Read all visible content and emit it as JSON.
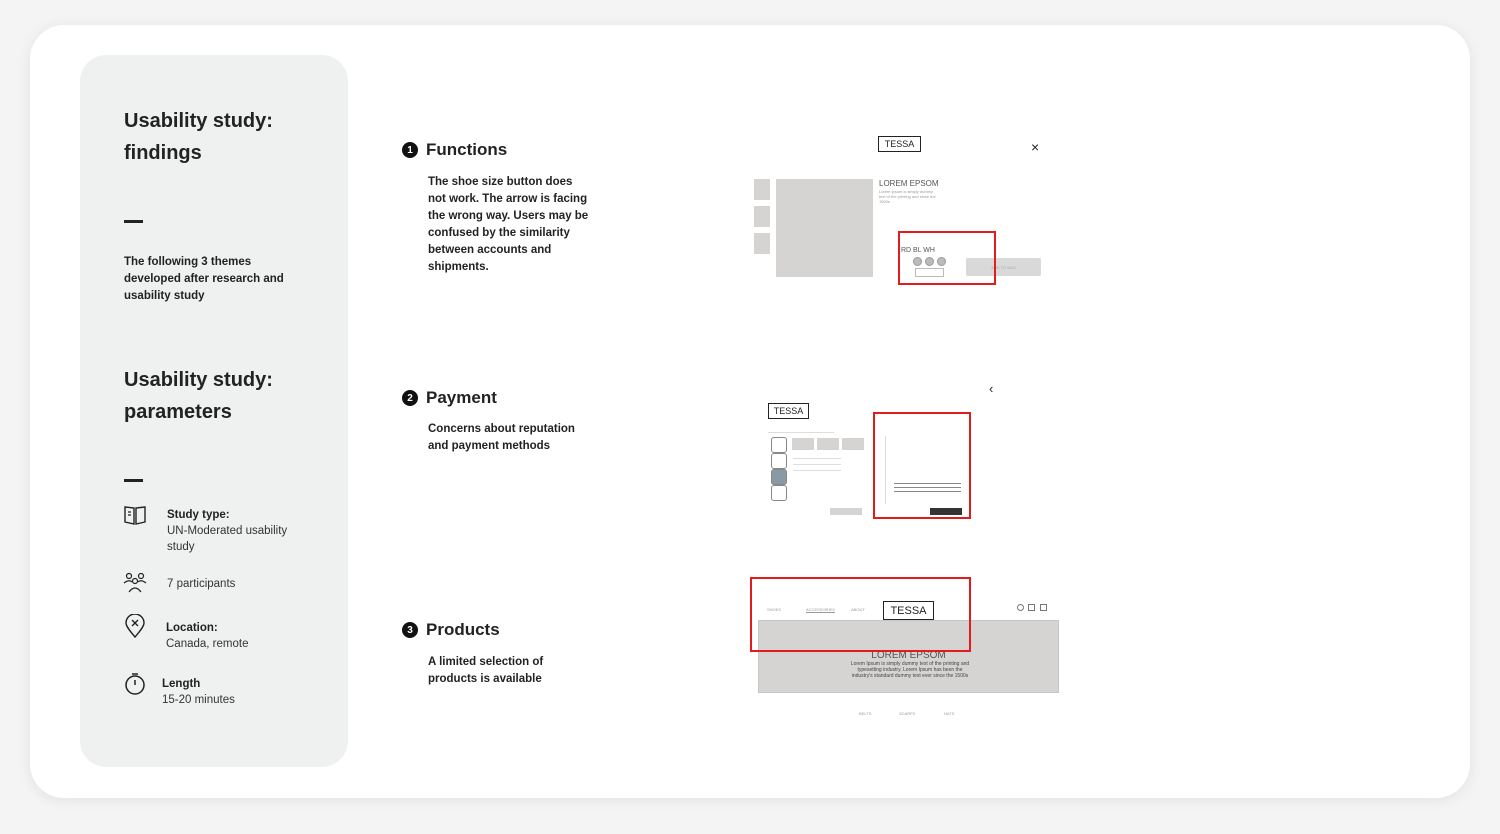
{
  "sidebar": {
    "findings_title_1": "Usability study:",
    "findings_title_2": "findings",
    "intro": "The following 3 themes developed after research and usability study",
    "parameters_title_1": "Usability study:",
    "parameters_title_2": "parameters",
    "params": {
      "study_type_label": "Study type:",
      "study_type_value": "UN-Moderated usability study",
      "participants": "7 participants",
      "location_label": "Location:",
      "location_value": "Canada, remote",
      "length_label": "Length",
      "length_value": "15-20 minutes"
    }
  },
  "sections": [
    {
      "number": "1",
      "title": "Functions",
      "desc": "The shoe size button does not work. The arrow is facing the wrong way. Users may be confused by the similarity between accounts and shipments."
    },
    {
      "number": "2",
      "title": "Payment",
      "desc": "Concerns about reputation and payment methods"
    },
    {
      "number": "3",
      "title": "Products",
      "desc": "A limited selection of products is available"
    }
  ],
  "mockups": {
    "m1": {
      "logo": "TESSA",
      "close": "×",
      "headline": "LOREM EPSOM",
      "body": "Lorem Ipsum is simply dummy text of the printing and since the 1500s",
      "colors": "RD  BL  WH",
      "cta": "ADD TO BAG"
    },
    "m2": {
      "logo": "TESSA",
      "back": "‹"
    },
    "m3": {
      "logo": "TESSA",
      "nav1": "SHOES",
      "nav2": "ACCESSORIES",
      "nav3": "ABOUT",
      "headline": "LOREM EPSOM",
      "body": "Lorem Ipsum is simply dummy text of the printing and typesetting industry. Lorem Ipsum has been the industry's standard dummy text ever since the 1500s",
      "cat1": "BELTS",
      "cat2": "SCARFS",
      "cat3": "HATS"
    }
  },
  "colors": {
    "highlight": "#e21c1c",
    "panel": "#eff1f0",
    "placeholder": "#d6d3d3"
  }
}
